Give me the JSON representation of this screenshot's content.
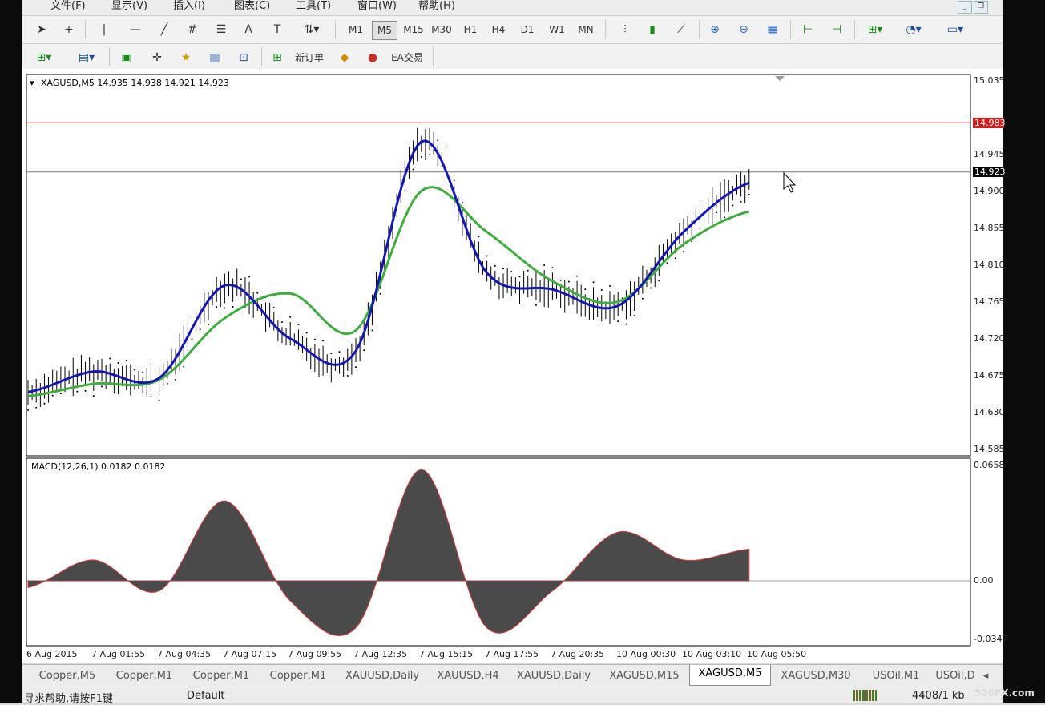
{
  "menu": [
    "文件(F)",
    "显示(V)",
    "插入(I)",
    "图表(C)",
    "工具(T)",
    "窗口(W)",
    "帮助(H)"
  ],
  "timeframes": [
    "M1",
    "M5",
    "M15",
    "M30",
    "H1",
    "H4",
    "D1",
    "W1",
    "MN"
  ],
  "active_timeframe": "M5",
  "toolbar2": {
    "new_order_label": "新订单",
    "ea_trading_label": "EA交易"
  },
  "chart": {
    "header": "XAGUSD,M5  14.935 14.938 14.921 14.923",
    "red_line_label": "14.983",
    "current_price_label": "14.923",
    "y_ticks": [
      "15.035",
      "14.990",
      "14.945",
      "14.900",
      "14.855",
      "14.810",
      "14.765",
      "14.720",
      "14.675",
      "14.630",
      "14.585"
    ],
    "colors": {
      "fast_ma": "#1616b4",
      "slow_ma": "#3fae3f",
      "red_line": "#d21b1b",
      "price_bars": "#000000",
      "macd_hist": "#4a4a4a",
      "macd_signal": "#e03a3a"
    }
  },
  "macd": {
    "label": "MACD(12,26,1) 0.0182 0.0182",
    "y_ticks": [
      "0.0658",
      "0.00",
      "-0.0347"
    ]
  },
  "x_ticks": [
    "6 Aug 2015",
    "7 Aug 01:55",
    "7 Aug 04:35",
    "7 Aug 07:15",
    "7 Aug 09:55",
    "7 Aug 12:35",
    "7 Aug 15:15",
    "7 Aug 17:55",
    "7 Aug 20:35",
    "10 Aug 00:30",
    "10 Aug 03:10",
    "10 Aug 05:50"
  ],
  "tabs": [
    "Copper,M5",
    "Copper,M1",
    "Copper,M1",
    "Copper,M1",
    "XAUUSD,Daily",
    "XAUUSD,H4",
    "XAUUSD,Daily",
    "XAGUSD,M15",
    "XAGUSD,M5",
    "XAGUSD,M30",
    "USOil,M1",
    "USOil,D"
  ],
  "active_tab_index": 8,
  "status": {
    "help": "寻求帮助,请按F1键",
    "profile": "Default",
    "traffic": "4408/1 kb"
  },
  "watermark": "520FX.com",
  "chart_data": {
    "type": "line",
    "title": "XAGUSD,M5",
    "x": [
      "6 Aug 2015",
      "7 Aug 01:55",
      "7 Aug 04:35",
      "7 Aug 07:15",
      "7 Aug 09:55",
      "7 Aug 12:35",
      "7 Aug 15:15",
      "7 Aug 17:55",
      "7 Aug 20:35",
      "10 Aug 00:30",
      "10 Aug 03:10",
      "10 Aug 05:50"
    ],
    "series": [
      {
        "name": "",
        "values": [
          14.655,
          14.68,
          14.672,
          14.785,
          14.72,
          14.705,
          14.96,
          14.8,
          14.78,
          14.76,
          14.85,
          14.91
        ]
      },
      {
        "name": "",
        "values": [
          14.65,
          14.665,
          14.67,
          14.745,
          14.775,
          14.73,
          14.9,
          14.85,
          14.79,
          14.765,
          14.835,
          14.875
        ]
      }
    ],
    "ylim": [
      14.585,
      15.035
    ],
    "grid": false,
    "horizontal_lines": [
      14.983,
      14.923
    ],
    "macd_values": [
      -0.004,
      0.012,
      -0.006,
      0.046,
      -0.012,
      -0.028,
      0.064,
      -0.028,
      -0.006,
      0.028,
      0.012,
      0.0182
    ],
    "macd_ylim": [
      -0.0347,
      0.0658
    ]
  }
}
